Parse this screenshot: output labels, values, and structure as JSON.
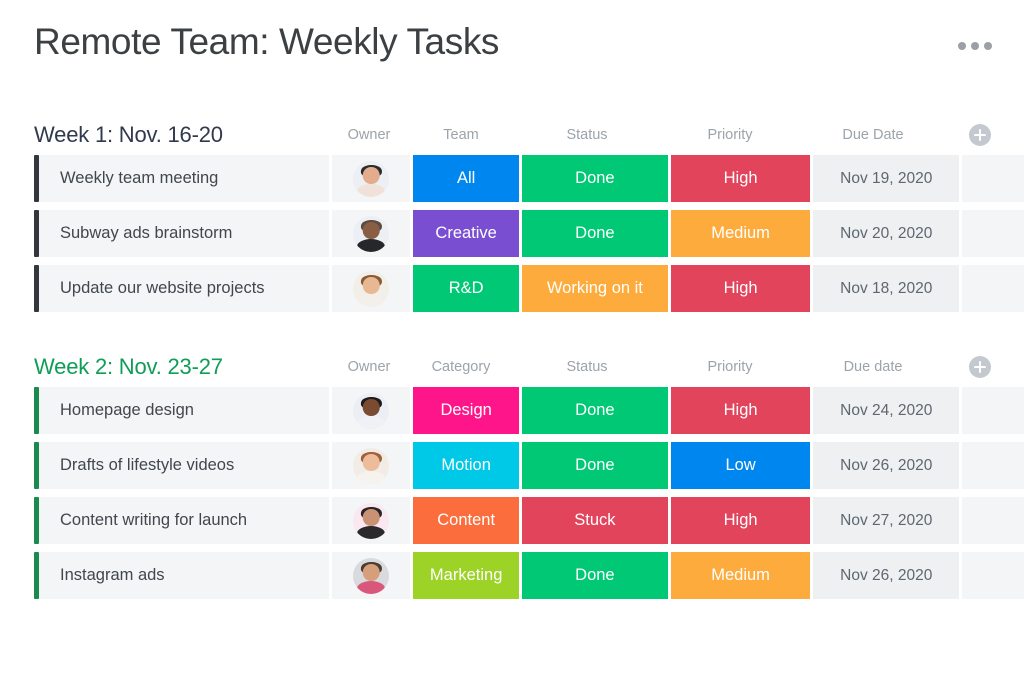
{
  "header": {
    "title": "Remote Team: Weekly Tasks",
    "menu_icon": "kebab-menu-icon"
  },
  "colors": {
    "status_done": "#00c875",
    "status_working": "#fdab3d",
    "status_stuck": "#e2445c",
    "priority_high": "#e2445c",
    "priority_medium": "#fdab3d",
    "priority_low": "#0086ef",
    "label_all": "#0086ef",
    "label_creative": "#7a4ed1",
    "label_rnd": "#00c875",
    "label_design": "#ff158a",
    "label_motion": "#00c9e8",
    "label_content": "#fb6d3c",
    "label_marketing": "#9cd326",
    "group1_accent": "#32373d",
    "group2_accent": "#1a8a4e",
    "date_cell_bg": "#eef0f2",
    "row_bg": "#f3f5f6"
  },
  "groups": [
    {
      "title": "Week 1: Nov. 16-20",
      "title_color": "#31394d",
      "accent": "#32373d",
      "add_column_label": "+",
      "columns": [
        {
          "label": "Owner"
        },
        {
          "label": "Team"
        },
        {
          "label": "Status"
        },
        {
          "label": "Priority"
        },
        {
          "label": "Due Date"
        }
      ],
      "rows": [
        {
          "task": "Weekly team meeting",
          "owner": "avatar-person-1",
          "label": "All",
          "label_color": "#0086ef",
          "status": "Done",
          "status_color": "#00c875",
          "priority": "High",
          "priority_color": "#e2445c",
          "due_date": "Nov 19, 2020"
        },
        {
          "task": "Subway ads brainstorm",
          "owner": "avatar-person-2",
          "label": "Creative",
          "label_color": "#7a4ed1",
          "status": "Done",
          "status_color": "#00c875",
          "priority": "Medium",
          "priority_color": "#fdab3d",
          "due_date": "Nov 20, 2020"
        },
        {
          "task": "Update our website projects",
          "owner": "avatar-person-3",
          "label": "R&D",
          "label_color": "#00c875",
          "status": "Working on it",
          "status_color": "#fdab3d",
          "priority": "High",
          "priority_color": "#e2445c",
          "due_date": "Nov 18, 2020"
        }
      ]
    },
    {
      "title": "Week 2: Nov. 23-27",
      "title_color": "#0f9d58",
      "accent": "#1a8a4e",
      "add_column_label": "+",
      "columns": [
        {
          "label": "Owner"
        },
        {
          "label": "Category"
        },
        {
          "label": "Status"
        },
        {
          "label": "Priority"
        },
        {
          "label": "Due date"
        }
      ],
      "rows": [
        {
          "task": "Homepage design",
          "owner": "avatar-person-4",
          "label": "Design",
          "label_color": "#ff158a",
          "status": "Done",
          "status_color": "#00c875",
          "priority": "High",
          "priority_color": "#e2445c",
          "due_date": "Nov 24, 2020"
        },
        {
          "task": "Drafts of lifestyle videos",
          "owner": "avatar-person-5",
          "label": "Motion",
          "label_color": "#00c9e8",
          "status": "Done",
          "status_color": "#00c875",
          "priority": "Low",
          "priority_color": "#0086ef",
          "due_date": "Nov 26, 2020"
        },
        {
          "task": "Content writing for launch",
          "owner": "avatar-person-6",
          "label": "Content",
          "label_color": "#fb6d3c",
          "status": "Stuck",
          "status_color": "#e2445c",
          "priority": "High",
          "priority_color": "#e2445c",
          "due_date": "Nov 27, 2020"
        },
        {
          "task": "Instagram ads",
          "owner": "avatar-person-7",
          "label": "Marketing",
          "label_color": "#9cd326",
          "status": "Done",
          "status_color": "#00c875",
          "priority": "Medium",
          "priority_color": "#fdab3d",
          "due_date": "Nov 26, 2020"
        }
      ]
    }
  ]
}
